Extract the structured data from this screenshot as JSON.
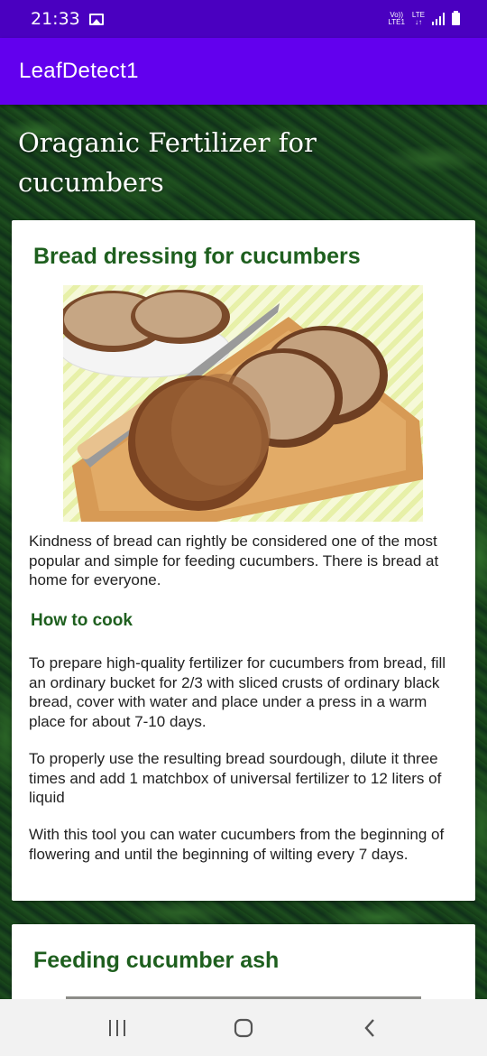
{
  "status_bar": {
    "time": "21:33",
    "volte": "Vo))",
    "lte_top": "LTE",
    "lte_bottom": "LTE1"
  },
  "app_bar": {
    "title": "LeafDetect1",
    "color": "#6200ee"
  },
  "page": {
    "heading": "Oraganic Fertilizer for cucumbers"
  },
  "card1": {
    "title": "Bread dressing for cucumbers",
    "image_alt": "bread",
    "intro": "Kindness of bread can rightly be considered one of the most popular and simple for feeding cucumbers. There is bread at home for everyone.",
    "subheading": "How to cook",
    "paragraphs": [
      "To prepare high-quality fertilizer for cucumbers from bread, fill an ordinary bucket for 2/3 with sliced crusts of ordinary black bread, cover with water and place under a press in a warm place for about 7-10 days.",
      "To properly use the resulting bread sourdough, dilute it three times and add 1 matchbox of universal fertilizer to 12 liters of liquid",
      "With this tool you can water cucumbers from the beginning of flowering and until the beginning of wilting every 7 days."
    ]
  },
  "card2": {
    "title": "Feeding cucumber ash"
  },
  "nav_bar": {
    "recents": "recents-icon",
    "home": "home-icon",
    "back": "back-icon"
  },
  "colors": {
    "heading_green": "#1e5f1e",
    "status_bar": "#4a00c0"
  }
}
